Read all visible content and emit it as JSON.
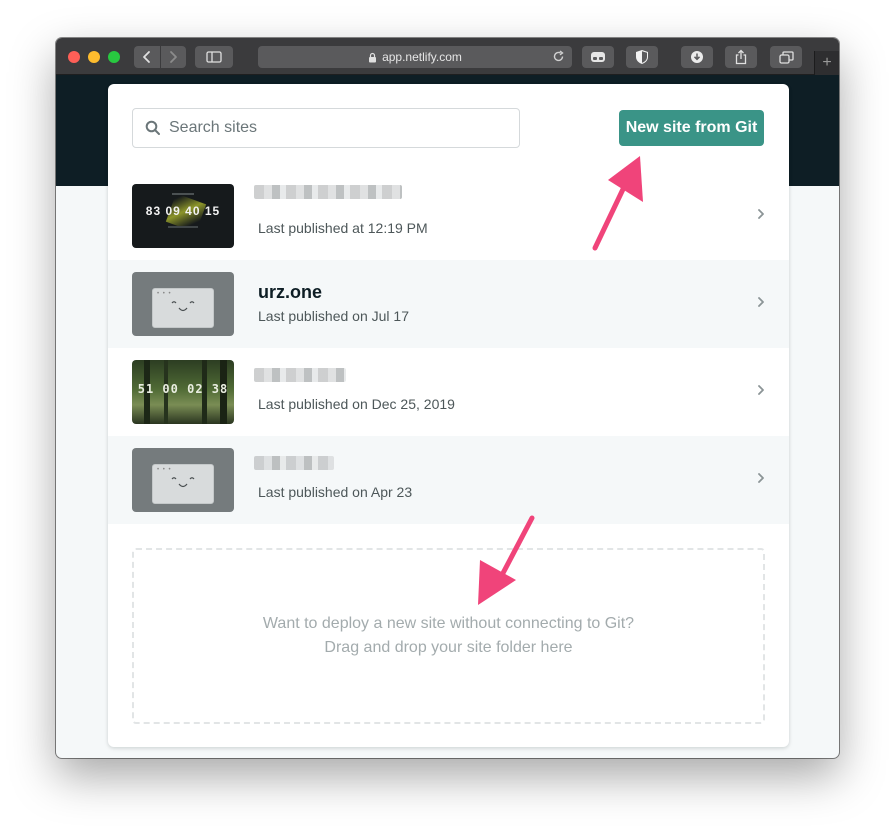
{
  "browser": {
    "address": "app.netlify.com",
    "new_tab_symbol": "+",
    "icons": [
      "back-icon",
      "forward-icon",
      "sidebar-icon",
      "lock-icon",
      "reload-icon",
      "extension-icon",
      "shield-icon",
      "download-icon",
      "share-icon",
      "tabs-icon"
    ]
  },
  "search": {
    "placeholder": "Search sites"
  },
  "new_site_button": {
    "label": "New site from Git",
    "color": "#3a9487"
  },
  "sites": [
    {
      "name": "",
      "meta": "Last published at 12:19 PM",
      "thumbnail": "countdown-dark",
      "thumb_text": "83 09 40 15"
    },
    {
      "name": "urz.one",
      "meta": "Last published on Jul 17",
      "thumbnail": "placeholder-face",
      "thumb_text": ""
    },
    {
      "name": "",
      "meta": "Last published on Dec 25, 2019",
      "thumbnail": "countdown-forest",
      "thumb_text": "51 00 02 38"
    },
    {
      "name": "",
      "meta": "Last published on Apr 23",
      "thumbnail": "placeholder-face",
      "thumb_text": ""
    }
  ],
  "dropzone": {
    "line1": "Want to deploy a new site without connecting to Git?",
    "line2": "Drag and drop your site folder here"
  },
  "annotations": {
    "arrow_color": "#f0447a"
  }
}
